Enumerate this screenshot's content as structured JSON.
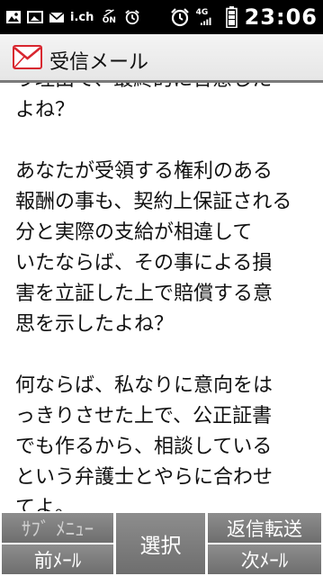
{
  "status_bar": {
    "icons": [
      "image-icon",
      "gallery-icon",
      "mail-icon",
      "ichi-icon",
      "sound-off-icon",
      "alarm-icon",
      "alarm-clock-icon",
      "network-4g-icon",
      "battery-icon"
    ],
    "ichi_label": "i.ch",
    "sound_label": "ON",
    "network_label": "4G",
    "time": "23:06"
  },
  "header": {
    "icon": "envelope-icon",
    "title": "受信メール"
  },
  "message": {
    "partial_line": "う理由で、最終的に合意した",
    "text": "よね？\n\nあなたが受領する権利のある\n報酬の事も、契約上保証される\n分と実際の支給が相違して\nいたならば、その事による損\n害を立証した上で賠償する意\n思を示したよね？\n\n何ならば、私なりに意向をは\nっきりさせた上で、公正証書\nでも作るから、相談している\nという弁護士とやらに合わせ\nてよ。"
  },
  "softkeys": {
    "submenu": "ｻﾌﾞ ﾒﾆｭｰ",
    "prev_mail": "前ﾒｰﾙ",
    "select": "選択",
    "reply_forward": "返信転送",
    "next_mail": "次ﾒｰﾙ"
  },
  "colors": {
    "statusbar_bg": "#000000",
    "softkey_bg": "#7d7d7d",
    "mail_icon_red": "#d8262f"
  }
}
